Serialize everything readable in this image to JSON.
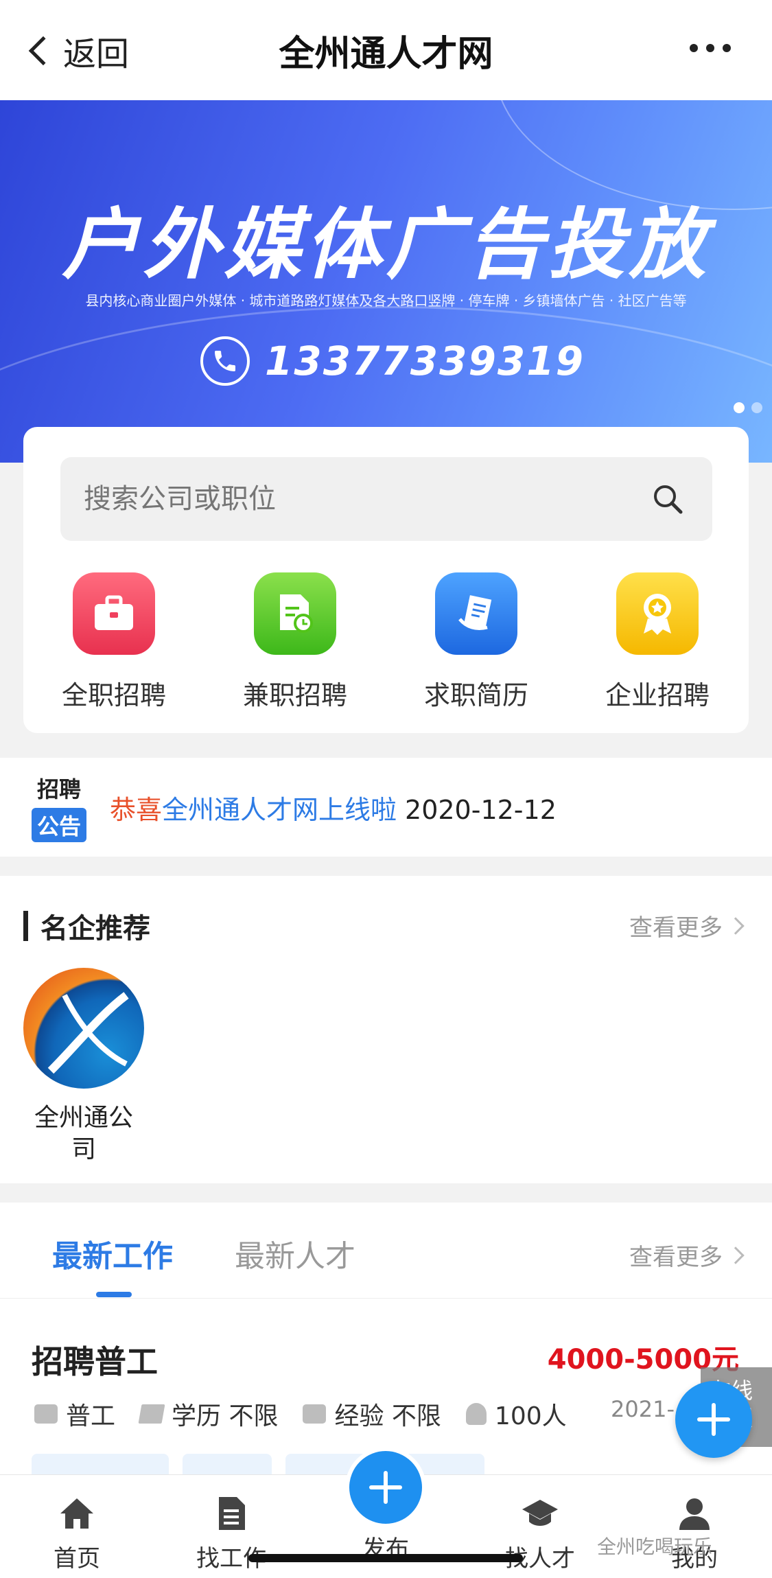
{
  "nav": {
    "back_label": "返回",
    "title": "全州通人才网"
  },
  "banner": {
    "title": "户外媒体广告投放",
    "subtitle": "县内核心商业圈户外媒体 · 城市道路路灯媒体及各大路口竖牌 · 停车牌 · 乡镇墙体广告 · 社区广告等",
    "phone": "13377339319"
  },
  "search": {
    "placeholder": "搜索公司或职位"
  },
  "categories": [
    {
      "label": "全职招聘",
      "icon": "briefcase-icon",
      "color": "#f0405e"
    },
    {
      "label": "兼职招聘",
      "icon": "document-clock-icon",
      "color": "#52c41a"
    },
    {
      "label": "求职简历",
      "icon": "resume-icon",
      "color": "#2f7de8"
    },
    {
      "label": "企业招聘",
      "icon": "award-badge-icon",
      "color": "#f7c60b"
    }
  ],
  "notice": {
    "badge_top": "招聘",
    "badge_bottom": "公告",
    "prefix": "恭喜",
    "text": "全州通人才网上线啦",
    "date": "2020-12-12"
  },
  "companies": {
    "title": "名企推荐",
    "more": "查看更多",
    "items": [
      {
        "name": "全州通公司"
      }
    ]
  },
  "jobs": {
    "tabs": [
      "最新工作",
      "最新人才"
    ],
    "more": "查看更多",
    "item": {
      "title": "招聘普工",
      "salary": "4000-5000元",
      "category": "普工",
      "education": "学历 不限",
      "experience": "经验 不限",
      "headcount": "100人",
      "date": "2021-"
    }
  },
  "side": {
    "online_label": "在线客服"
  },
  "tabbar": [
    "首页",
    "找工作",
    "发布",
    "找人才",
    "我的"
  ],
  "watermark": "全州吃喝玩乐"
}
